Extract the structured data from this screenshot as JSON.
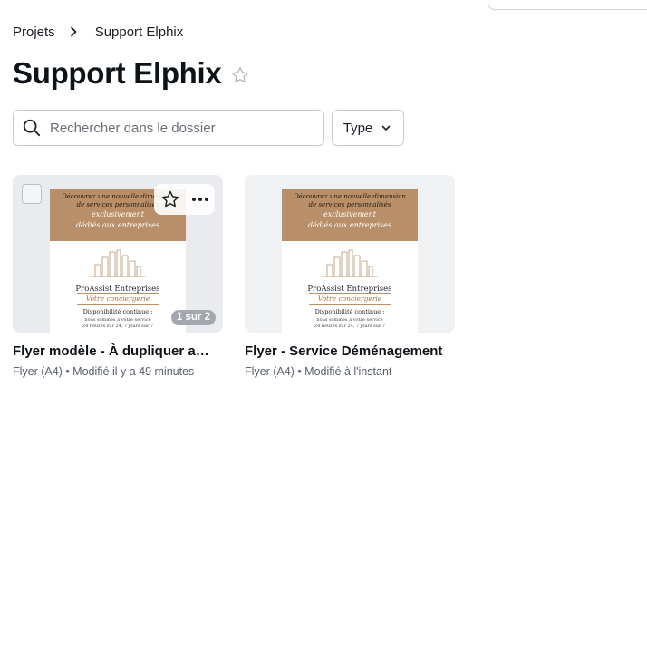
{
  "breadcrumb": {
    "root": "Projets",
    "current": "Support Elphix"
  },
  "page": {
    "title": "Support Elphix"
  },
  "search": {
    "placeholder": "Rechercher dans le dossier",
    "value": ""
  },
  "filter": {
    "type_label": "Type"
  },
  "flyer_preview": {
    "band_line1": "Découvrez une nouvelle dimension",
    "band_line2": "de services personnalisés",
    "band_line3": "exclusivement",
    "band_line4": "dédiés aux entreprises",
    "brand": "ProAssist Entreprises",
    "tagline": "Votre conciergerie",
    "dispo": "Disponibilité continue :",
    "small1": "nous sommes à votre service",
    "small2": "24 heures sur 24, 7 jours sur 7"
  },
  "designs": [
    {
      "name": "Flyer modèle - À dupliquer ava…",
      "meta": "Flyer (A4) • Modifié il y a 49 minutes",
      "page_badge": "1 sur 2"
    },
    {
      "name": "Flyer - Service Déménagement",
      "meta": "Flyer (A4) • Modifié à l'instant"
    }
  ],
  "colors": {
    "accent_band": "#b88f68",
    "thumb_bg": "#e9ebee",
    "text_primary": "#0e1318"
  }
}
